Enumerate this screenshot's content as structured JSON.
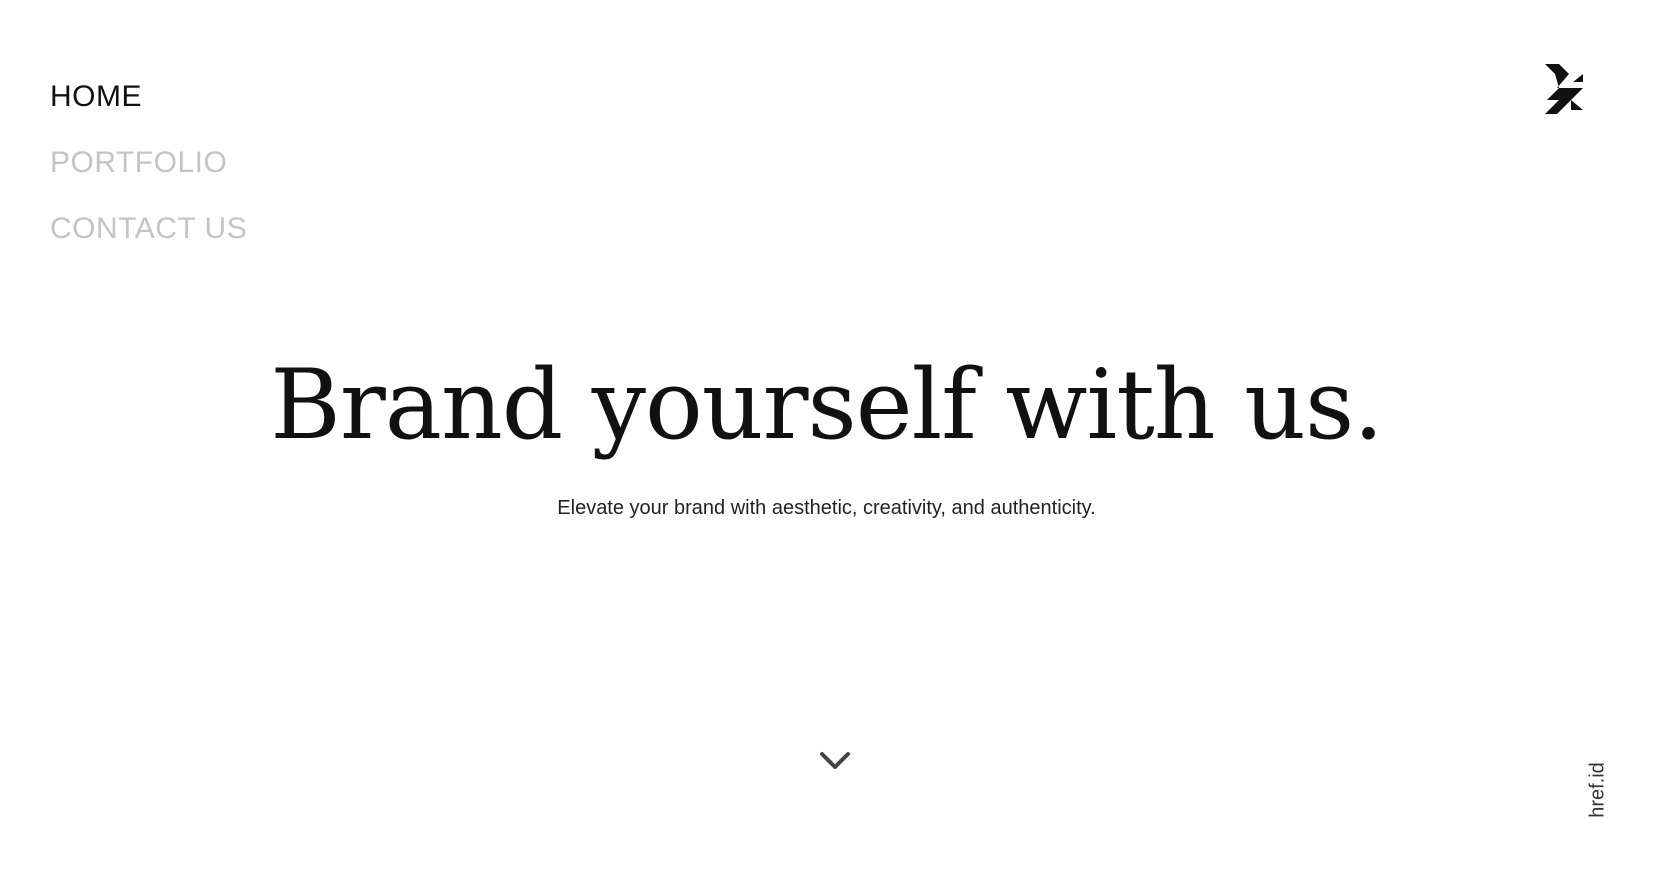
{
  "nav": {
    "items": [
      {
        "label": "HOME",
        "active": true
      },
      {
        "label": "PORTFOLIO",
        "active": false
      },
      {
        "label": "CONTACT US",
        "active": false
      }
    ]
  },
  "logo": {
    "icon": "brand-logo-icon"
  },
  "hero": {
    "title": "Brand yourself with us.",
    "subtitle": "Elevate your brand with aesthetic, creativity, and authenticity."
  },
  "scroll": {
    "icon": "chevron-down-icon"
  },
  "side": {
    "brand": "href.id"
  },
  "colors": {
    "active": "#111111",
    "inactive": "#c4c4c4",
    "background": "#ffffff"
  }
}
